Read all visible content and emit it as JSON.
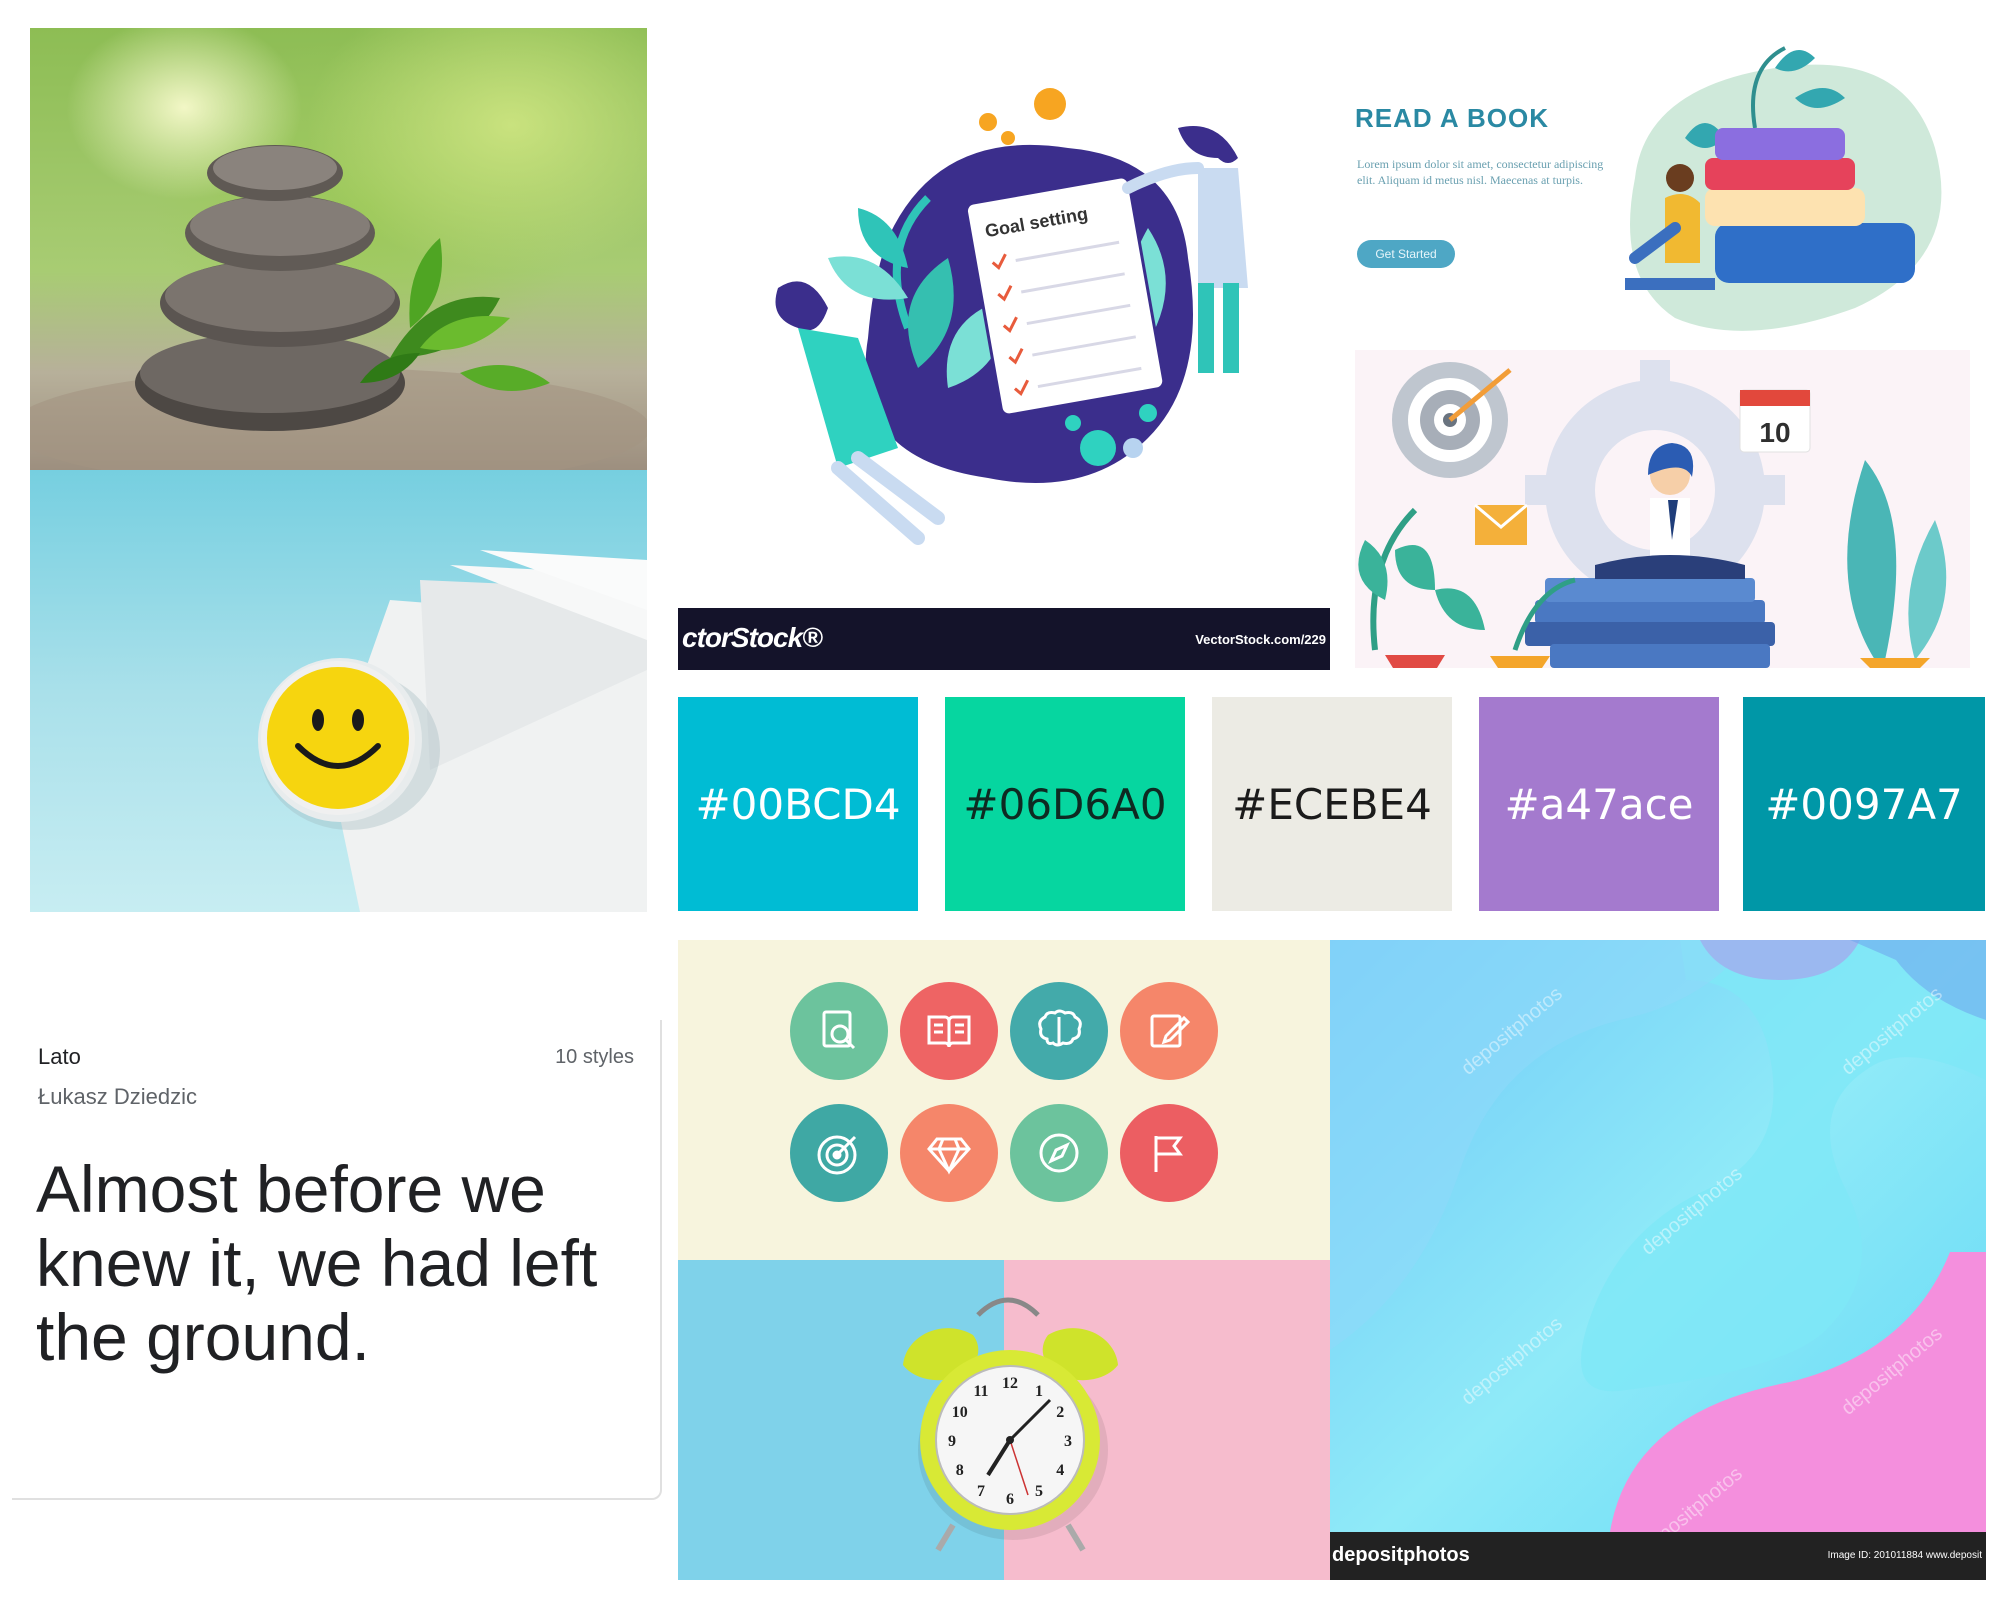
{
  "palette": {
    "swatches": [
      {
        "label": "#00BCD4",
        "color": "#00BCD4",
        "text_color": "#ffffff"
      },
      {
        "label": "#06D6A0",
        "color": "#06D6A0",
        "text_color": "#0e2a22"
      },
      {
        "label": "#ECEBE4",
        "color": "#ECEBE4",
        "text_color": "#1b1b1b"
      },
      {
        "label": "#a47ace",
        "color": "#a47ace",
        "text_color": "#ffffff"
      },
      {
        "label": "#0097A7",
        "color": "#0097A7",
        "text_color": "#ffffff"
      }
    ]
  },
  "goal_illustration": {
    "card_title": "Goal setting",
    "banner_left": "ctorStock®",
    "banner_right": "VectorStock.com/229"
  },
  "book_banner": {
    "title": "READ A BOOK",
    "body": "Lorem ipsum dolor sit amet, consectetur adipiscing elit. Aliquam id metus nisl. Maecenas at turpis.",
    "button": "Get Started"
  },
  "meditation_illustration": {
    "calendar_number": "10"
  },
  "font_card": {
    "font_name": "Lato",
    "styles": "10 styles",
    "designer": "Łukasz Dziedzic",
    "sample": "Almost before we knew it, we had left the ground."
  },
  "clock_photo": {
    "numbers": [
      "12",
      "1",
      "2",
      "3",
      "4",
      "5",
      "6",
      "7",
      "8",
      "9",
      "10",
      "11"
    ]
  },
  "abstract_image": {
    "watermark": "depositphotos",
    "footer_left": "depositphotos",
    "footer_right": "Image ID: 201011884   www.deposit"
  },
  "icons": [
    "search-document-icon",
    "open-book-icon",
    "brain-icon",
    "edit-icon",
    "target-icon",
    "diamond-icon",
    "compass-icon",
    "flag-icon"
  ]
}
